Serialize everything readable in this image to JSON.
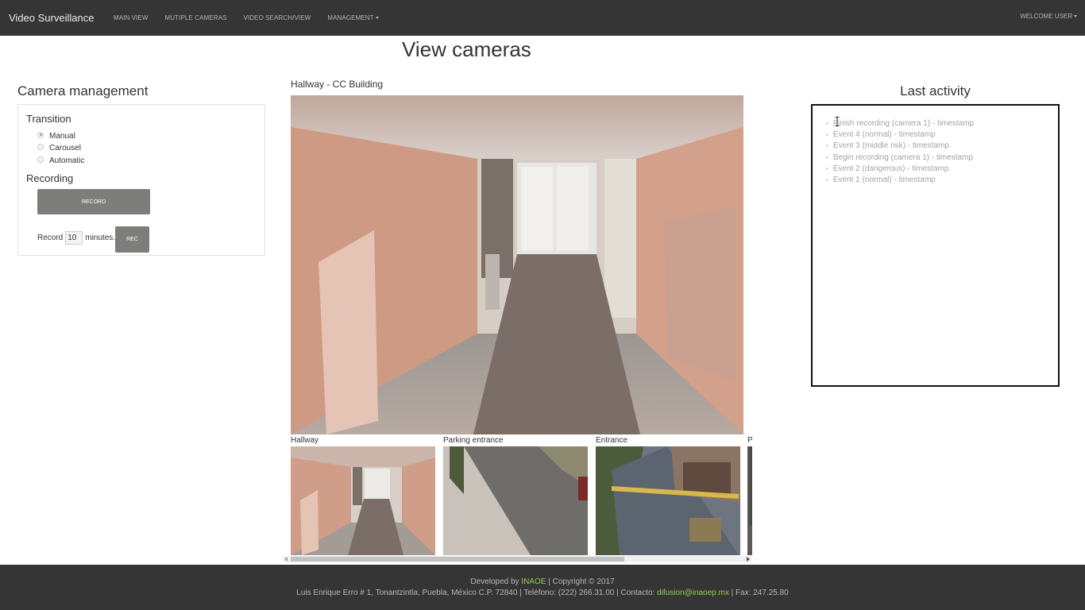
{
  "navbar": {
    "brand": "Video Surveillance",
    "links": [
      "MAIN VIEW",
      "MUTIPLE CAMERAS",
      "VIDEO SEARCH/VIEW",
      "MANAGEMENT"
    ],
    "user_menu": "WELCOME USER"
  },
  "page_title": "View cameras",
  "camera_management": {
    "title": "Camera management",
    "transition_label": "Transition",
    "options": [
      "Manual",
      "Carousel",
      "Automatic"
    ],
    "selected": "Manual",
    "recording_label": "Recording",
    "record_button": "RECORD",
    "record_prefix": "Record",
    "record_minutes": "10",
    "record_suffix": "minutes.",
    "rec_button": "REC"
  },
  "main_camera": {
    "title": "Hallway - CC Building"
  },
  "thumbnails": [
    {
      "label": "Hallway"
    },
    {
      "label": "Parking entrance"
    },
    {
      "label": "Entrance"
    },
    {
      "label": "P"
    }
  ],
  "last_activity": {
    "title": "Last activity",
    "items": [
      "Finish recording (camera 1) - timestamp",
      "Event 4 (normal) - timestamp",
      "Event 3 (middle risk) - timestamp",
      "Begin recording (camera 1) - timestamp",
      "Event 2 (dangerous) - timestamp",
      "Event 1 (normal) - timestamp"
    ]
  },
  "footer": {
    "developed_by_prefix": "Developed by",
    "org": "INAOE",
    "copyright": "| Copyright © 2017",
    "address": "Luis Enrique Erro # 1, Tonantzintla, Puebla, México C.P. 72840 | Teléfono: (222) 266.31.00 | Contacto:",
    "email": "difusion@inaoep.mx",
    "fax": "| Fax: 247.25.80"
  },
  "colors": {
    "navbar_bg": "#353535",
    "button_gray": "#7d7d7b",
    "footer_link_green": "#8fd14f"
  }
}
